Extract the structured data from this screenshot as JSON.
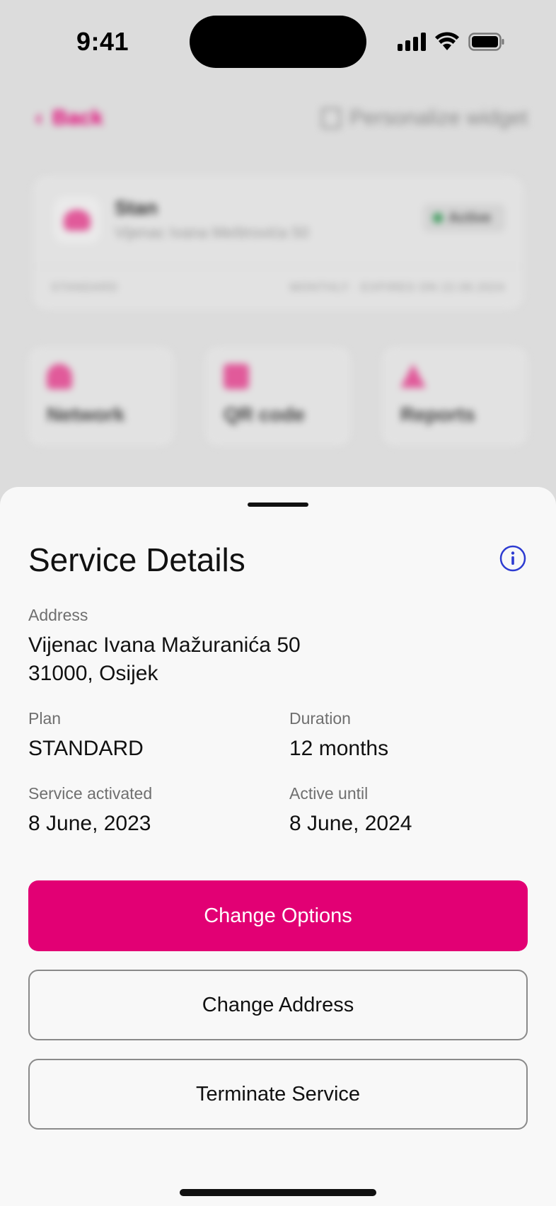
{
  "status_bar": {
    "time": "9:41"
  },
  "background": {
    "back_label": "Back",
    "personalize_label": "Personalize widget",
    "card": {
      "title": "Stan",
      "subtitle": "Vijenac Ivana Meštrovića 50",
      "badge": "Active",
      "footer_left": "STANDARD",
      "footer_right": "MONTHLY · EXPIRES ON 22.06.2024"
    },
    "tiles": [
      {
        "label": "Network",
        "icon": "wifi-icon"
      },
      {
        "label": "QR code",
        "icon": "qr-code-icon"
      },
      {
        "label": "Reports",
        "icon": "warning-triangle-icon"
      }
    ]
  },
  "sheet": {
    "title": "Service Details",
    "address": {
      "label": "Address",
      "line1": "Vijenac Ivana Mažuranića 50",
      "line2": "31000, Osijek"
    },
    "plan": {
      "label": "Plan",
      "value": "STANDARD"
    },
    "duration": {
      "label": "Duration",
      "value": "12 months"
    },
    "activated": {
      "label": "Service activated",
      "value": "8 June, 2023"
    },
    "active_until": {
      "label": "Active until",
      "value": "8 June, 2024"
    },
    "buttons": {
      "change_options": "Change Options",
      "change_address": "Change Address",
      "terminate": "Terminate Service"
    }
  },
  "colors": {
    "brand": "#e20074",
    "info_accent": "#2d3bd1",
    "sheet_bg": "#f8f8f8"
  }
}
